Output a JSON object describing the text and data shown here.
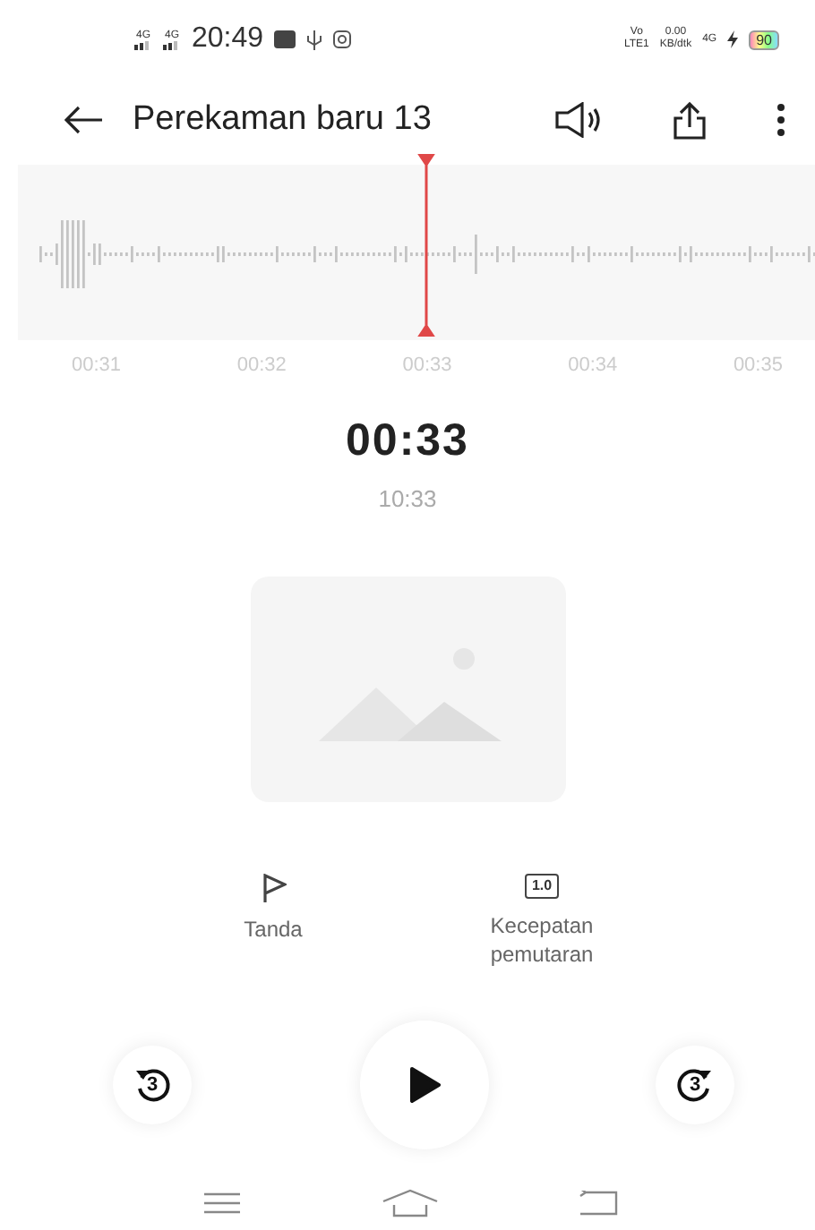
{
  "status_bar": {
    "network_left": [
      "4G",
      "4G"
    ],
    "time": "20:49",
    "volte": [
      "Vo",
      "LTE1"
    ],
    "speed": [
      "0.00",
      "KB/dtk"
    ],
    "network_right": "4G",
    "battery": "90"
  },
  "header": {
    "title": "Perekaman baru 13"
  },
  "timeline": {
    "ticks": [
      "00:31",
      "00:32",
      "00:33",
      "00:34",
      "00:35"
    ]
  },
  "current_time": "00:33",
  "total_time": "10:33",
  "actions": [
    {
      "kind": "flag",
      "label": "Tanda"
    },
    {
      "kind": "speed",
      "badge": "1.0",
      "label": "Kecepatan pemutaran"
    }
  ],
  "playback": {
    "rewind": "3",
    "forward": "3",
    "playing": false
  }
}
